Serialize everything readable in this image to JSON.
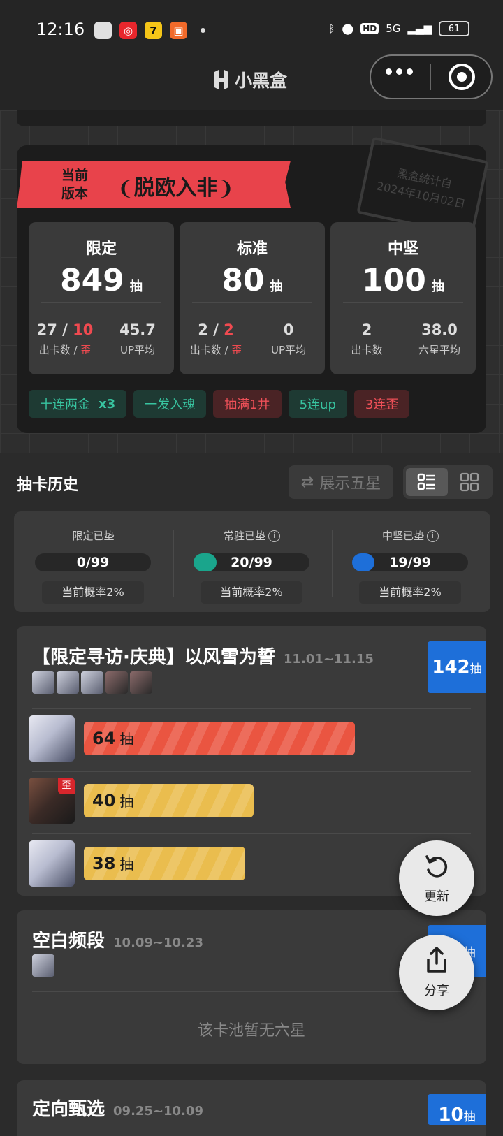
{
  "status": {
    "time": "12:16",
    "net": "5G",
    "hd": "HD",
    "battery": "61"
  },
  "nav": {
    "title": "小黑盒"
  },
  "summary": {
    "banner_small": "当前\n版本",
    "banner_title": "脱欧入非",
    "stamp": "黑盒统计自\n2024年10月02日",
    "stats": [
      {
        "title": "限定",
        "big": "849",
        "unit": "抽",
        "a_v1": "27",
        "a_sep": " / ",
        "a_v2": "10",
        "a_lbl1": "出卡数 / ",
        "a_lbl2": "歪",
        "b_v": "45.7",
        "b_lbl": "UP平均"
      },
      {
        "title": "标准",
        "big": "80",
        "unit": "抽",
        "a_v1": "2",
        "a_sep": " / ",
        "a_v2": "2",
        "a_lbl1": "出卡数 / ",
        "a_lbl2": "歪",
        "b_v": "0",
        "b_lbl": "UP平均"
      },
      {
        "title": "中坚",
        "big": "100",
        "unit": "抽",
        "a_v1": "2",
        "a_sep": "",
        "a_v2": "",
        "a_lbl1": "出卡数",
        "a_lbl2": "",
        "b_v": "38.0",
        "b_lbl": "六星平均"
      }
    ],
    "tags": [
      {
        "label": "十连两金",
        "extra": "x3",
        "tone": "green"
      },
      {
        "label": "一发入魂",
        "extra": "",
        "tone": "green"
      },
      {
        "label": "抽满1井",
        "extra": "",
        "tone": "red"
      },
      {
        "label": "5连up",
        "extra": "",
        "tone": "green"
      },
      {
        "label": "3连歪",
        "extra": "",
        "tone": "red"
      }
    ]
  },
  "history": {
    "title": "抽卡历史",
    "show_five": "展示五星",
    "pity": [
      {
        "label": "限定已垫",
        "value": "0/99",
        "fill": 0,
        "color": "",
        "rate": "当前概率2%"
      },
      {
        "label": "常驻已垫",
        "value": "20/99",
        "fill": 0.2,
        "color": "#1aa58c",
        "rate": "当前概率2%"
      },
      {
        "label": "中坚已垫",
        "value": "19/99",
        "fill": 0.19,
        "color": "#1e6fd9",
        "rate": "当前概率2%"
      }
    ],
    "pools": [
      {
        "name": "【限定寻访·庆典】以风雪为誓",
        "date": "11.01~11.15",
        "total": "142",
        "unit": "抽",
        "rows": [
          {
            "pulls": "64",
            "unit": "抽",
            "off": false
          },
          {
            "pulls": "40",
            "unit": "抽",
            "off": true,
            "badge": "歪"
          },
          {
            "pulls": "38",
            "unit": "抽",
            "off": false
          }
        ]
      },
      {
        "name": "空白频段",
        "date": "10.09~10.23",
        "total": "10",
        "unit": "抽",
        "empty": "该卡池暂无六星"
      },
      {
        "name": "定向甄选",
        "date": "09.25~10.09",
        "total": "10",
        "unit": "抽"
      }
    ]
  },
  "fab": {
    "refresh": "更新",
    "share": "分享"
  },
  "colors": {
    "accent_red": "#e8434b",
    "bar_orange": "#ea5541",
    "bar_yellow": "#eabd4e",
    "blue": "#1e6fd9",
    "teal": "#1aa58c"
  }
}
